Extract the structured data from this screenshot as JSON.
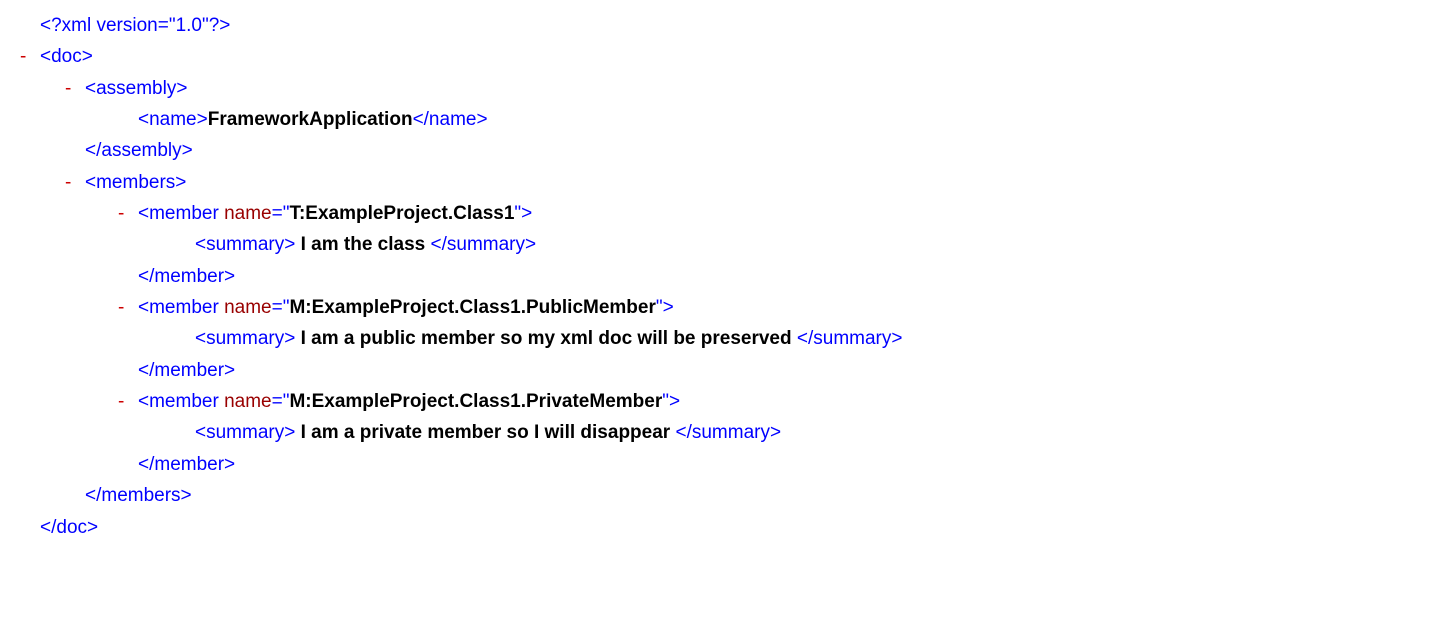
{
  "xml_decl": "<?xml version=\"1.0\"?>",
  "doc_open": "<doc>",
  "doc_close": "</doc>",
  "assembly_open": "<assembly>",
  "assembly_close": "</assembly>",
  "name_open": "<name>",
  "name_close": "</name>",
  "name_value": "FrameworkApplication",
  "members_open": "<members>",
  "members_close": "</members>",
  "member_tag_open": "<member ",
  "member_attr_name": "name",
  "member_tag_end": ">",
  "member_close": "</member>",
  "summary_open": "<summary>",
  "summary_close": "</summary>",
  "dash": "-",
  "eq": "=",
  "q": "\"",
  "m1_name": "T:ExampleProject.Class1",
  "m1_summary": "I am the class",
  "m2_name": "M:ExampleProject.Class1.PublicMember",
  "m2_summary": "I am a public member so my xml doc will be preserved",
  "m3_name": "M:ExampleProject.Class1.PrivateMember",
  "m3_summary": "I am a private member so I will disappear"
}
